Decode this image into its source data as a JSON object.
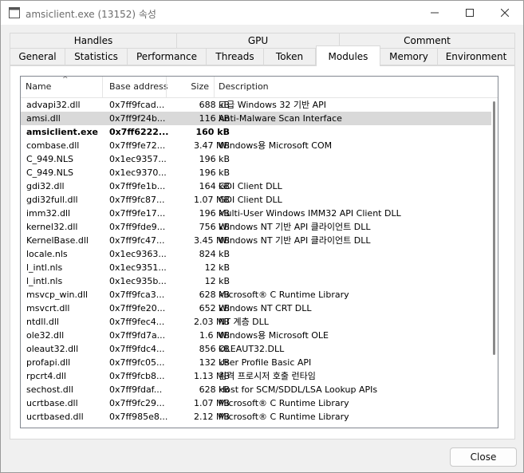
{
  "window": {
    "title": "amsiclient.exe (13152) 속성",
    "controls": {
      "minimize": "–",
      "maximize": "☐",
      "close": "✕"
    }
  },
  "tabs": {
    "row1": [
      "Handles",
      "GPU",
      "Comment"
    ],
    "row2": [
      "General",
      "Statistics",
      "Performance",
      "Threads",
      "Token",
      "Modules",
      "Memory",
      "Environment"
    ],
    "active": "Modules"
  },
  "columns": {
    "name": "Name",
    "base": "Base address",
    "size": "Size",
    "desc": "Description",
    "sort_indicator": "^"
  },
  "modules": [
    {
      "name": "advapi32.dll",
      "base": "0x7ff9fcad...",
      "size": "688 kB",
      "desc": "고급 Windows 32 기반 API"
    },
    {
      "name": "amsi.dll",
      "base": "0x7ff9f24b...",
      "size": "116 kB",
      "desc": "Anti-Malware Scan Interface"
    },
    {
      "name": "amsiclient.exe",
      "base": "0x7ff6222...",
      "size": "160 kB",
      "desc": ""
    },
    {
      "name": "combase.dll",
      "base": "0x7ff9fe72...",
      "size": "3.47 MB",
      "desc": "Windows용 Microsoft COM"
    },
    {
      "name": "C_949.NLS",
      "base": "0x1ec9357...",
      "size": "196 kB",
      "desc": ""
    },
    {
      "name": "C_949.NLS",
      "base": "0x1ec9370...",
      "size": "196 kB",
      "desc": ""
    },
    {
      "name": "gdi32.dll",
      "base": "0x7ff9fe1b...",
      "size": "164 kB",
      "desc": "GDI Client DLL"
    },
    {
      "name": "gdi32full.dll",
      "base": "0x7ff9fc87...",
      "size": "1.07 MB",
      "desc": "GDI Client DLL"
    },
    {
      "name": "imm32.dll",
      "base": "0x7ff9fe17...",
      "size": "196 kB",
      "desc": "Multi-User Windows IMM32 API Client DLL"
    },
    {
      "name": "kernel32.dll",
      "base": "0x7ff9fde9...",
      "size": "756 kB",
      "desc": "Windows NT 기반 API 클라이언트 DLL"
    },
    {
      "name": "KernelBase.dll",
      "base": "0x7ff9fc47...",
      "size": "3.45 MB",
      "desc": "Windows NT 기반 API 클라이언트 DLL"
    },
    {
      "name": "locale.nls",
      "base": "0x1ec9363...",
      "size": "824 kB",
      "desc": ""
    },
    {
      "name": "l_intl.nls",
      "base": "0x1ec9351...",
      "size": "12 kB",
      "desc": ""
    },
    {
      "name": "l_intl.nls",
      "base": "0x1ec935b...",
      "size": "12 kB",
      "desc": ""
    },
    {
      "name": "msvcp_win.dll",
      "base": "0x7ff9fca3...",
      "size": "628 kB",
      "desc": "Microsoft® C Runtime Library"
    },
    {
      "name": "msvcrt.dll",
      "base": "0x7ff9fe20...",
      "size": "652 kB",
      "desc": "Windows NT CRT DLL"
    },
    {
      "name": "ntdll.dll",
      "base": "0x7ff9fec4...",
      "size": "2.03 MB",
      "desc": "NT 계층 DLL"
    },
    {
      "name": "ole32.dll",
      "base": "0x7ff9fd7a...",
      "size": "1.6 MB",
      "desc": "Windows용 Microsoft OLE"
    },
    {
      "name": "oleaut32.dll",
      "base": "0x7ff9fdc4...",
      "size": "856 kB",
      "desc": "OLEAUT32.DLL"
    },
    {
      "name": "profapi.dll",
      "base": "0x7ff9fc05...",
      "size": "132 kB",
      "desc": "User Profile Basic API"
    },
    {
      "name": "rpcrt4.dll",
      "base": "0x7ff9fcb8...",
      "size": "1.13 MB",
      "desc": "원격 프로시저 호출 런타임"
    },
    {
      "name": "sechost.dll",
      "base": "0x7ff9fdaf...",
      "size": "628 kB",
      "desc": "Host for SCM/SDDL/LSA Lookup APIs"
    },
    {
      "name": "ucrtbase.dll",
      "base": "0x7ff9fc29...",
      "size": "1.07 MB",
      "desc": "Microsoft® C Runtime Library"
    },
    {
      "name": "ucrtbased.dll",
      "base": "0x7ff985e8...",
      "size": "2.12 MB",
      "desc": "Microsoft® C Runtime Library"
    },
    {
      "name": "",
      "base": "",
      "size": "",
      "desc": ""
    }
  ],
  "selected_module": "amsi.dll",
  "highlighted_module": "amsiclient.exe",
  "buttons": {
    "close": "Close"
  }
}
